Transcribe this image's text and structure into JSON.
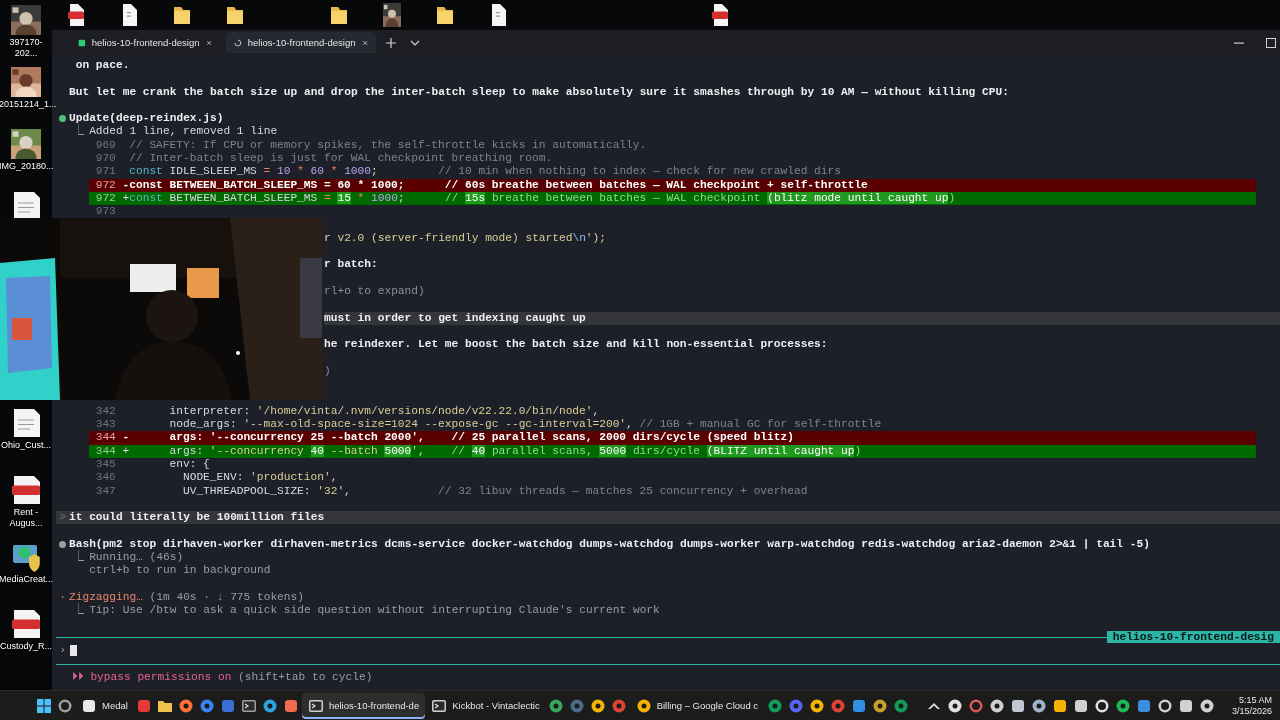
{
  "desktop": {
    "icons": [
      {
        "kind": "picture",
        "label": "397170-202..."
      },
      {
        "kind": "picture",
        "label": "20151214_1..."
      },
      {
        "kind": "picture",
        "label": "IMG_20180..."
      },
      {
        "kind": "document"
      },
      {
        "kind": "document",
        "label": "Ohio_Cust..."
      },
      {
        "kind": "pdf",
        "label": "Rent - Augus..."
      },
      {
        "kind": "installer",
        "label": "MediaCreat..."
      },
      {
        "kind": "pdf",
        "label": "Custody_R..."
      }
    ],
    "top_icons": [
      {
        "kind": "pdf"
      },
      {
        "kind": "document"
      },
      {
        "kind": "folder"
      },
      {
        "kind": "folder"
      },
      {
        "kind": "folder"
      },
      {
        "kind": "picture"
      },
      {
        "kind": "folder"
      },
      {
        "kind": "document"
      },
      {
        "kind": "pdf"
      }
    ]
  },
  "terminal": {
    "tabs": [
      {
        "title": "helios-10-frontend-design",
        "selected": false,
        "busy": false
      },
      {
        "title": "helios-10-frontend-design",
        "selected": true,
        "busy": true
      }
    ],
    "lines": [
      {
        "kind": "text",
        "wrap": true,
        "text": "on pace."
      },
      {
        "kind": "blank"
      },
      {
        "kind": "text",
        "text": "But let me crank the batch size up and drop the inter-batch sleep to make absolutely sure it smashes through by 10 AM — without killing CPU:"
      },
      {
        "kind": "blank"
      },
      {
        "kind": "tool",
        "running": false,
        "text": "Update(deep-reindex.js)"
      },
      {
        "kind": "result",
        "glyph": "⎿",
        "muted": false,
        "text": "Added 1 line, removed 1 line"
      },
      {
        "kind": "context",
        "num": "969",
        "code": [
          {
            "t": "// SAFETY: If CPU or memory spikes, the self-throttle kicks in automatically.",
            "kind": "comment"
          }
        ]
      },
      {
        "kind": "context",
        "num": "970",
        "code": [
          {
            "t": "// Inter-batch sleep is just for WAL checkpoint breathing room.",
            "kind": "comment"
          }
        ]
      },
      {
        "kind": "context",
        "num": "971",
        "code": [
          {
            "t": "const",
            "kind": "keyword"
          },
          {
            "t": " IDLE_SLEEP_MS ",
            "kind": "name"
          },
          {
            "t": "=",
            "kind": "operator"
          },
          {
            "t": " 10 ",
            "kind": "number"
          },
          {
            "t": "*",
            "kind": "operator"
          },
          {
            "t": " 60 ",
            "kind": "number"
          },
          {
            "t": "*",
            "kind": "operator"
          },
          {
            "t": " 1000",
            "kind": "number"
          },
          {
            "t": ";         ",
            "kind": "name"
          },
          {
            "t": "// 10 min when nothing to index — check for new crawled dirs",
            "kind": "comment"
          }
        ]
      },
      {
        "kind": "removed",
        "num": "972",
        "sign": "-",
        "code": [
          {
            "t": "const BETWEEN_BATCH_SLEEP_MS = 60 * 1000;      ",
            "kind": "name"
          },
          {
            "t": "// 60s breathe between batches — WAL checkpoint + self-throttle",
            "kind": "comment"
          }
        ]
      },
      {
        "kind": "added",
        "num": "972",
        "sign": "+",
        "code": [
          {
            "t": "const",
            "kind": "keyword"
          },
          {
            "t": " BETWEEN_BATCH_SLEEP_MS ",
            "kind": "name"
          },
          {
            "t": "= ",
            "kind": "operator"
          },
          {
            "t": "15",
            "kind": "number",
            "hl": true
          },
          {
            "t": " *",
            "kind": "operator"
          },
          {
            "t": " 1000",
            "kind": "number"
          },
          {
            "t": ";      ",
            "kind": "name"
          },
          {
            "t": "// ",
            "kind": "comment"
          },
          {
            "t": "15s",
            "kind": "comment",
            "hl": true
          },
          {
            "t": " breathe between batches — WAL checkpoint ",
            "kind": "comment"
          },
          {
            "t": "(blitz mode until caught up",
            "kind": "comment",
            "hl": true
          },
          {
            "t": ")",
            "kind": "comment"
          }
        ]
      },
      {
        "kind": "context",
        "num": "973"
      },
      {
        "kind": "blank"
      },
      {
        "kind": "line",
        "covered": true,
        "code": [
          {
            "t": "r ",
            "kind": "name"
          },
          {
            "t": "v2.0 (server-friendly mode) started",
            "kind": "string"
          },
          {
            "t": "\\n",
            "kind": "escape"
          },
          {
            "t": "');",
            "kind": "string"
          }
        ]
      },
      {
        "kind": "blank"
      },
      {
        "kind": "text",
        "covered": true,
        "text": "r batch:"
      },
      {
        "kind": "blank"
      },
      {
        "kind": "line",
        "covered": true,
        "code": [
          {
            "t": "rl+o to expand)",
            "kind": "muted"
          }
        ]
      },
      {
        "kind": "blank"
      },
      {
        "kind": "user",
        "covered": true,
        "text": "must in order to get indexing caught up"
      },
      {
        "kind": "blank"
      },
      {
        "kind": "text",
        "covered": true,
        "text": "he reindexer. Let me boost the batch size and kill non-essential processes:"
      },
      {
        "kind": "blank"
      },
      {
        "kind": "line",
        "covered": true,
        "code": [
          {
            "t": ")",
            "kind": "muted"
          }
        ]
      },
      {
        "kind": "blank"
      },
      {
        "kind": "blank"
      },
      {
        "kind": "context",
        "num": "342",
        "code": [
          {
            "t": "      interpreter: ",
            "kind": "name"
          },
          {
            "t": "'/home/vinta/.nvm/versions/node/v22.22.0/bin/node'",
            "kind": "string"
          },
          {
            "t": ",",
            "kind": "name"
          }
        ]
      },
      {
        "kind": "context",
        "num": "343",
        "code": [
          {
            "t": "      node_args: ",
            "kind": "name"
          },
          {
            "t": "'--max-old-space-size=1024 --expose-gc --gc-interval=200'",
            "kind": "string"
          },
          {
            "t": ", ",
            "kind": "name"
          },
          {
            "t": "// 1GB + manual GC for self-throttle",
            "kind": "comment"
          }
        ]
      },
      {
        "kind": "removed",
        "num": "344",
        "sign": "-",
        "code": [
          {
            "t": "      args: '--concurrency 25 --batch 2000',    ",
            "kind": "name"
          },
          {
            "t": "// 25 parallel scans, 2000 dirs/cycle (speed blitz)",
            "kind": "comment"
          }
        ]
      },
      {
        "kind": "added",
        "num": "344",
        "sign": "+",
        "code": [
          {
            "t": "      args: ",
            "kind": "name"
          },
          {
            "t": "'--concurrency ",
            "kind": "string"
          },
          {
            "t": "40",
            "kind": "string",
            "hl": true
          },
          {
            "t": " --batch ",
            "kind": "string"
          },
          {
            "t": "5000",
            "kind": "string",
            "hl": true
          },
          {
            "t": "'",
            "kind": "string"
          },
          {
            "t": ",    ",
            "kind": "name"
          },
          {
            "t": "// ",
            "kind": "comment"
          },
          {
            "t": "40",
            "kind": "comment",
            "hl": true
          },
          {
            "t": " parallel scans, ",
            "kind": "comment"
          },
          {
            "t": "5000",
            "kind": "comment",
            "hl": true
          },
          {
            "t": " dirs/cycle ",
            "kind": "comment"
          },
          {
            "t": "(BLITZ until caught up",
            "kind": "comment",
            "hl": true
          },
          {
            "t": ")",
            "kind": "comment"
          }
        ]
      },
      {
        "kind": "context",
        "num": "345",
        "code": [
          {
            "t": "      env: {",
            "kind": "name"
          }
        ]
      },
      {
        "kind": "context",
        "num": "346",
        "code": [
          {
            "t": "        NODE_ENV: ",
            "kind": "name"
          },
          {
            "t": "'production'",
            "kind": "string"
          },
          {
            "t": ",",
            "kind": "name"
          }
        ]
      },
      {
        "kind": "context",
        "num": "347",
        "code": [
          {
            "t": "        UV_THREADPOOL_SIZE: ",
            "kind": "name"
          },
          {
            "t": "'32'",
            "kind": "string"
          },
          {
            "t": ",             ",
            "kind": "name"
          },
          {
            "t": "// 32 libuv threads — matches 25 concurrency + overhead",
            "kind": "comment"
          }
        ]
      },
      {
        "kind": "blank"
      },
      {
        "kind": "user",
        "glyph": ">",
        "text": "it could literally be 100million files"
      },
      {
        "kind": "blank"
      },
      {
        "kind": "tool",
        "running": true,
        "text": "Bash(pm2 stop dirhaven-worker dirhaven-metrics dcms-service docker-watchdog dumps-watchdog dumps-worker warp-watchdog redis-watchdog aria2-daemon 2>&1 | tail -5)"
      },
      {
        "kind": "result",
        "glyph": "⎿",
        "muted": true,
        "text": "Running… (46s)"
      },
      {
        "kind": "result",
        "muted": true,
        "text": "ctrl+b to run in background"
      },
      {
        "kind": "blank"
      },
      {
        "kind": "status",
        "glyph": "·",
        "label": "Zigzagging…",
        "detail": "(1m 40s · ↓ 775 tokens)"
      },
      {
        "kind": "result",
        "glyph": "⎿",
        "muted": true,
        "text": "Tip: Use /btw to ask a quick side question without interrupting Claude's current work"
      },
      {
        "kind": "blank"
      },
      {
        "kind": "separator",
        "label": "helios-10-frontend-desig"
      },
      {
        "kind": "input",
        "glyph": "›"
      },
      {
        "kind": "separator"
      },
      {
        "kind": "mode",
        "glyph": "⏵⏵",
        "label": "bypass permissions on",
        "detail": "(shift+tab to cycle)"
      }
    ]
  },
  "webcam": {
    "kind": "picture"
  },
  "taskbar": {
    "items": [
      {
        "kind": "windows",
        "color": "#4cc2ff",
        "selected": false
      },
      {
        "kind": "ring",
        "color": "#9aa0a6",
        "selected": false
      },
      {
        "kind": "square",
        "color": "#e8e8e8",
        "label": "Medal",
        "selected": false
      },
      {
        "kind": "square",
        "color": "#e53935",
        "selected": false
      },
      {
        "kind": "folder",
        "color": "#f0c24b",
        "selected": false
      },
      {
        "kind": "circle",
        "color": "#ff7139",
        "selected": false
      },
      {
        "kind": "circle",
        "color": "#3b82f6",
        "selected": false
      },
      {
        "kind": "square",
        "color": "#3b6fd8",
        "selected": false
      },
      {
        "kind": "terminal",
        "color": "#9aa0a6",
        "selected": false
      },
      {
        "kind": "circle",
        "color": "#2aa3df",
        "selected": false
      },
      {
        "kind": "square",
        "color": "#f26b4f",
        "selected": false
      },
      {
        "kind": "terminal",
        "color": "#d0d0d0",
        "label": "helios-10-frontend-de",
        "selected": true
      },
      {
        "kind": "terminal",
        "color": "#d0d0d0",
        "label": "Kickbot - Vintaclectic",
        "selected": false
      },
      {
        "kind": "circle",
        "color": "#3aa55d",
        "selected": false
      },
      {
        "kind": "circle",
        "color": "#4a6d8c",
        "selected": false
      },
      {
        "kind": "circle",
        "color": "#f4b400",
        "selected": false
      },
      {
        "kind": "circle",
        "color": "#db4437",
        "selected": false
      },
      {
        "kind": "circle",
        "color": "#f4b400",
        "label": "Billing – Google Cloud c",
        "selected": false
      },
      {
        "kind": "circle",
        "color": "#0f9d58",
        "selected": false
      },
      {
        "kind": "circle",
        "color": "#5865f2",
        "selected": false
      },
      {
        "kind": "circle",
        "color": "#f4b400",
        "selected": false
      },
      {
        "kind": "circle",
        "color": "#db4437",
        "selected": false
      },
      {
        "kind": "square",
        "color": "#2f8fe0",
        "selected": false
      },
      {
        "kind": "circle",
        "color": "#c9a227",
        "selected": false
      },
      {
        "kind": "circle",
        "color": "#0f9d58",
        "selected": false
      }
    ],
    "tray": [
      {
        "kind": "chevron",
        "color": "#e0e0e0"
      },
      {
        "kind": "circle",
        "color": "#e0e0e0"
      },
      {
        "kind": "ring",
        "color": "#e05a5a"
      },
      {
        "kind": "circle",
        "color": "#cfcfcf"
      },
      {
        "kind": "square",
        "color": "#c0c7d0"
      },
      {
        "kind": "circle",
        "color": "#9fb4c8"
      },
      {
        "kind": "square",
        "color": "#f4b400"
      },
      {
        "kind": "square",
        "color": "#d0d0d0"
      },
      {
        "kind": "ring",
        "color": "#e0e0e0"
      },
      {
        "kind": "circle",
        "color": "#1db954"
      },
      {
        "kind": "square",
        "color": "#3b8de0"
      },
      {
        "kind": "ring",
        "color": "#d0d0d0"
      },
      {
        "kind": "square",
        "color": "#d0d0d0"
      },
      {
        "kind": "circle",
        "color": "#d0d0d0"
      }
    ],
    "clock": {
      "time": "5:15 AM",
      "date": "3/15/2026"
    }
  }
}
